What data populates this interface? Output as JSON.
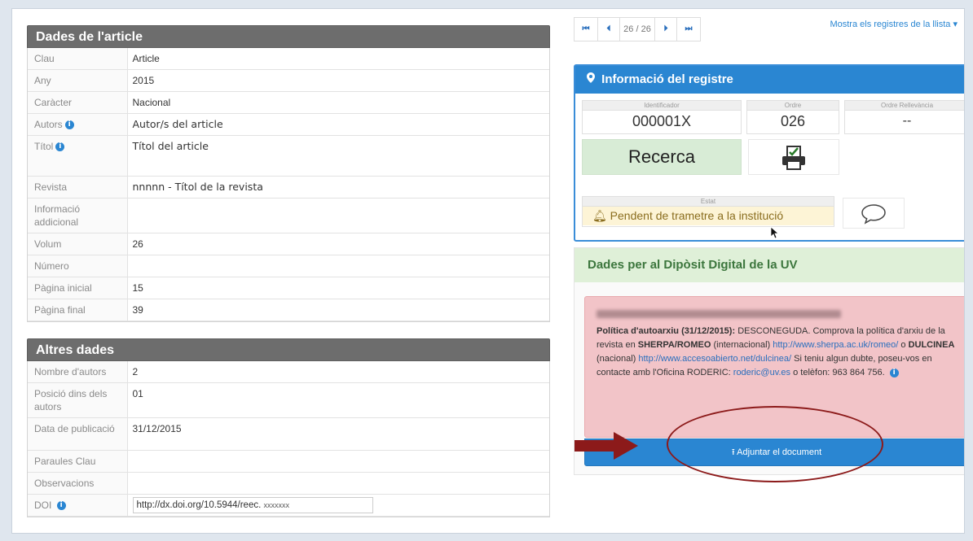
{
  "article_section": {
    "title": "Dades de l'article",
    "rows": [
      {
        "label": "Clau",
        "value": "Article",
        "info": false
      },
      {
        "label": "Any",
        "value": "2015",
        "info": false
      },
      {
        "label": "Caràcter",
        "value": "Nacional",
        "info": false
      },
      {
        "label": "Autors",
        "value": "Autor/s del  article",
        "info": true
      },
      {
        "label": "Títol",
        "value": "Títol del article",
        "info": true
      },
      {
        "label": "Revista",
        "value": "nnnnn - Títol de la  revista",
        "info": false
      },
      {
        "label": "Informació addicional",
        "value": "",
        "info": false
      },
      {
        "label": "Volum",
        "value": "26",
        "info": false
      },
      {
        "label": "Número",
        "value": "",
        "info": false
      },
      {
        "label": "Pàgina inicial",
        "value": "15",
        "info": false
      },
      {
        "label": "Pàgina final",
        "value": "39",
        "info": false
      }
    ]
  },
  "other_section": {
    "title": "Altres dades",
    "rows": [
      {
        "label": "Nombre d'autors",
        "value": "2",
        "info": false
      },
      {
        "label": "Posició dins dels autors",
        "value": "01",
        "info": false
      },
      {
        "label": "Data de publicació",
        "value": "31/12/2015",
        "info": false
      },
      {
        "label": "Paraules Clau",
        "value": "",
        "info": false
      },
      {
        "label": "Observacions",
        "value": "",
        "info": false
      }
    ],
    "doi_label": "DOI",
    "doi_value": "http://dx.doi.org/10.5944/reec.",
    "doi_suffix": "xxxxxxx"
  },
  "pager": {
    "first": "⏮",
    "prev": "⏴",
    "count": "26 / 26",
    "next": "⏵",
    "last": "⏭"
  },
  "list_link": "Mostra els registres de la llista ▾",
  "registre": {
    "title": "Informació del registre",
    "identificador_label": "Identificador",
    "identificador": "000001X",
    "ordre_label": "Ordre",
    "ordre": "026",
    "ordre_rel_label": "Ordre Rellevància",
    "ordre_rel": "--",
    "tipus": "Recerca",
    "estat_label": "Estat",
    "estat": "Pendent de trametre a la institució"
  },
  "diposit": {
    "title": "Dades per al Dipòsit Digital de la UV",
    "politica_label": "Política d'autoarxiu (31/12/2015):",
    "politica_text": "DESCONEGUDA. Comprova la política d'arxiu de la revista en",
    "sherpa": "SHERPA/ROMEO",
    "internacional": "(internacional)",
    "sherpa_url": "http://www.sherpa.ac.uk/romeo/",
    "o": "o",
    "dulcinea": "DULCINEA",
    "nacional": "(nacional)",
    "dulcinea_url": "http://www.accesoabierto.net/dulcinea/",
    "dubte": "Si teniu algun dubte, poseu-vos en contacte amb l'Oficina RODERIC:",
    "email": "roderic@uv.es",
    "telefon": "o telèfon: 963 864 756.",
    "attach_button": "Adjuntar el document"
  }
}
